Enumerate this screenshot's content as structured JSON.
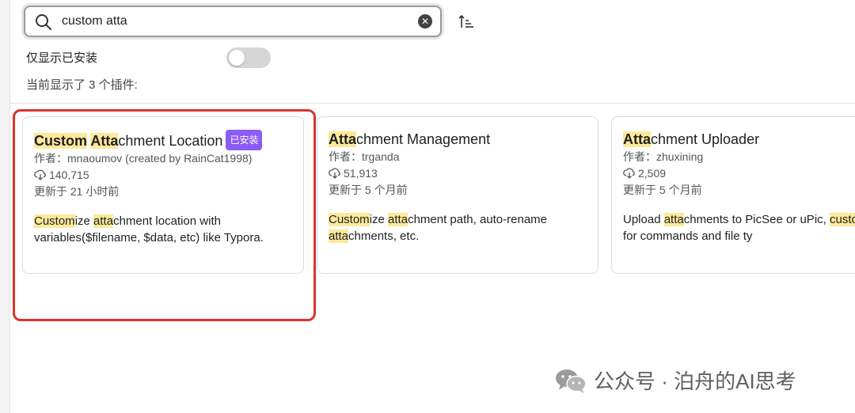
{
  "search": {
    "value": "custom atta"
  },
  "filter": {
    "installed_only_label": "仅显示已安装",
    "installed_only": false
  },
  "result_count_text": "当前显示了 3 个插件:",
  "colors": {
    "highlight": "#fde99a",
    "badge": "#8b5cf6",
    "frame": "#d9342b"
  },
  "cards": [
    {
      "title_parts": [
        {
          "text": "Custom",
          "highlight": true
        },
        {
          "text": " ",
          "highlight": false
        },
        {
          "text": "Atta",
          "highlight": true
        },
        {
          "text": "chment Location",
          "highlight": false
        }
      ],
      "badge": "已安装",
      "author": "作者：mnaoumov (created by RainCat1998)",
      "downloads": "140,715",
      "updated": "更新于 21 小时前",
      "desc_parts": [
        {
          "text": "Custom",
          "highlight": true
        },
        {
          "text": "ize ",
          "highlight": false
        },
        {
          "text": "atta",
          "highlight": true
        },
        {
          "text": "chment location with variables($filename, $data, etc) like Typora.",
          "highlight": false
        }
      ]
    },
    {
      "title_parts": [
        {
          "text": "Atta",
          "highlight": true
        },
        {
          "text": "chment Management",
          "highlight": false
        }
      ],
      "badge": "",
      "author": "作者：trganda",
      "downloads": "51,913",
      "updated": "更新于 5 个月前",
      "desc_parts": [
        {
          "text": "Custom",
          "highlight": true
        },
        {
          "text": "ize ",
          "highlight": false
        },
        {
          "text": "atta",
          "highlight": true
        },
        {
          "text": "chment path, auto-rename ",
          "highlight": false
        },
        {
          "text": "atta",
          "highlight": true
        },
        {
          "text": "chments, etc.",
          "highlight": false
        }
      ]
    },
    {
      "title_parts": [
        {
          "text": "Atta",
          "highlight": true
        },
        {
          "text": "chment Uploader",
          "highlight": false
        }
      ],
      "badge": "",
      "author": "作者：zhuxining",
      "downloads": "2,509",
      "updated": "更新于 5 个月前",
      "desc_parts": [
        {
          "text": "Upload ",
          "highlight": false
        },
        {
          "text": "atta",
          "highlight": true
        },
        {
          "text": "chments to PicSee or uPic, ",
          "highlight": false
        },
        {
          "text": "custom",
          "highlight": true
        },
        {
          "text": "ization for commands and file ty",
          "highlight": false
        }
      ]
    }
  ],
  "watermark": {
    "text": "公众号 · 泊舟的AI思考",
    "icon": "wechat-icon"
  }
}
